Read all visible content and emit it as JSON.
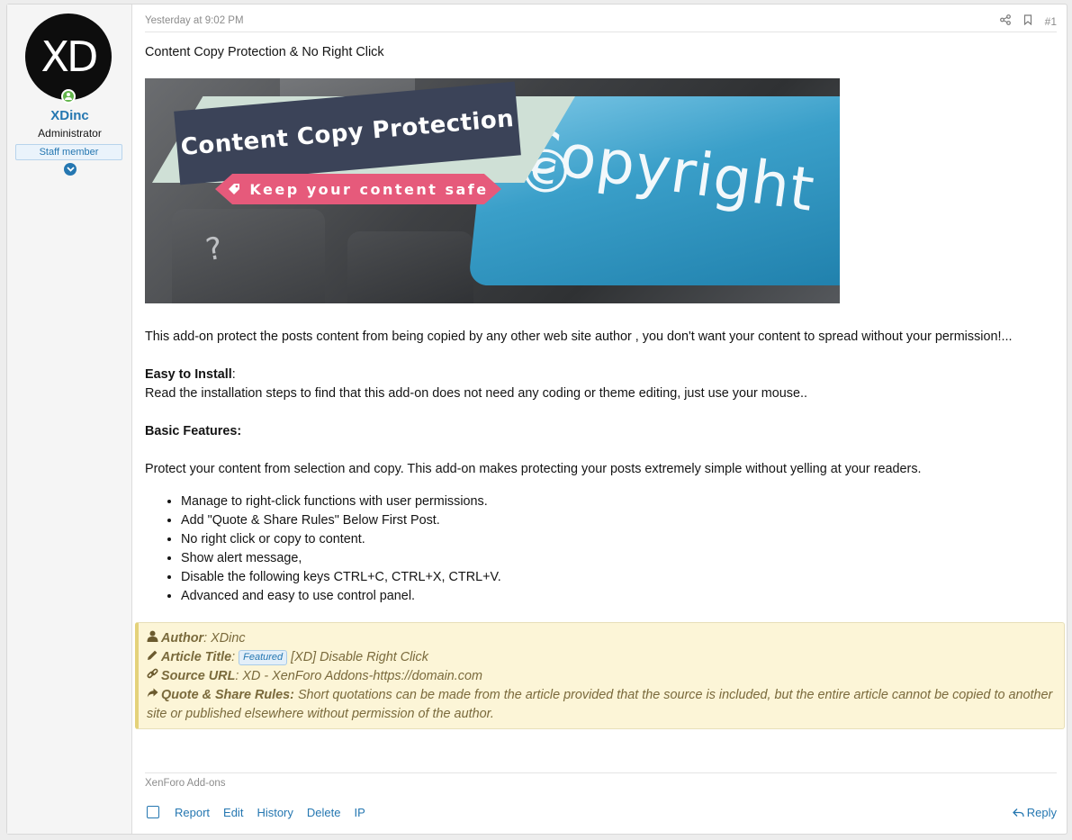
{
  "user": {
    "avatar_text": "XD",
    "username": "XDinc",
    "title": "Administrator",
    "badge": "Staff member"
  },
  "post": {
    "date": "Yesterday at 9:02 PM",
    "number": "#1",
    "title_line": "Content Copy Protection & No Right Click",
    "banner": {
      "heading": "Content Copy Protection",
      "tagline": "Keep your content safe",
      "key_word": "Copyright ©",
      "key_symbol": "?"
    },
    "intro": "This add-on protect the posts content from being copied by any other web site author , you don't want your content to spread without your permission!...",
    "easy_install_label": "Easy to Install",
    "easy_install_colon": ":",
    "easy_install_text": "Read the installation steps to find that this add-on does not need any coding or theme editing, just use your mouse..",
    "basic_features_label": "Basic Features:",
    "protect_text": "Protect your content from selection and copy. This add-on makes protecting your posts extremely simple without yelling at your readers.",
    "features": [
      "Manage to right-click functions with user permissions.",
      "Add \"Quote & Share Rules\" Below First Post.",
      "No right click or copy to content.",
      "Show alert message,",
      "Disable the following keys CTRL+C, CTRL+X, CTRL+V.",
      "Advanced and easy to use control panel."
    ],
    "quote": {
      "author_label": "Author",
      "author_value": ": XDinc",
      "article_label": "Article Title",
      "article_colon": ":",
      "featured_badge": "Featured",
      "article_value": "[XD] Disable Right Click",
      "source_label": "Source URL",
      "source_value": ": XD - XenForo Addons-https://domain.com",
      "rules_label": "Quote & Share Rules:",
      "rules_value": "Short quotations can be made from the article provided that the source is included, but the entire article cannot be copied to another site or published elsewhere without permission of the author."
    },
    "category": "XenForo Add-ons"
  },
  "actions": {
    "report": "Report",
    "edit": "Edit",
    "history": "History",
    "delete": "Delete",
    "ip": "IP",
    "reply": "Reply"
  }
}
